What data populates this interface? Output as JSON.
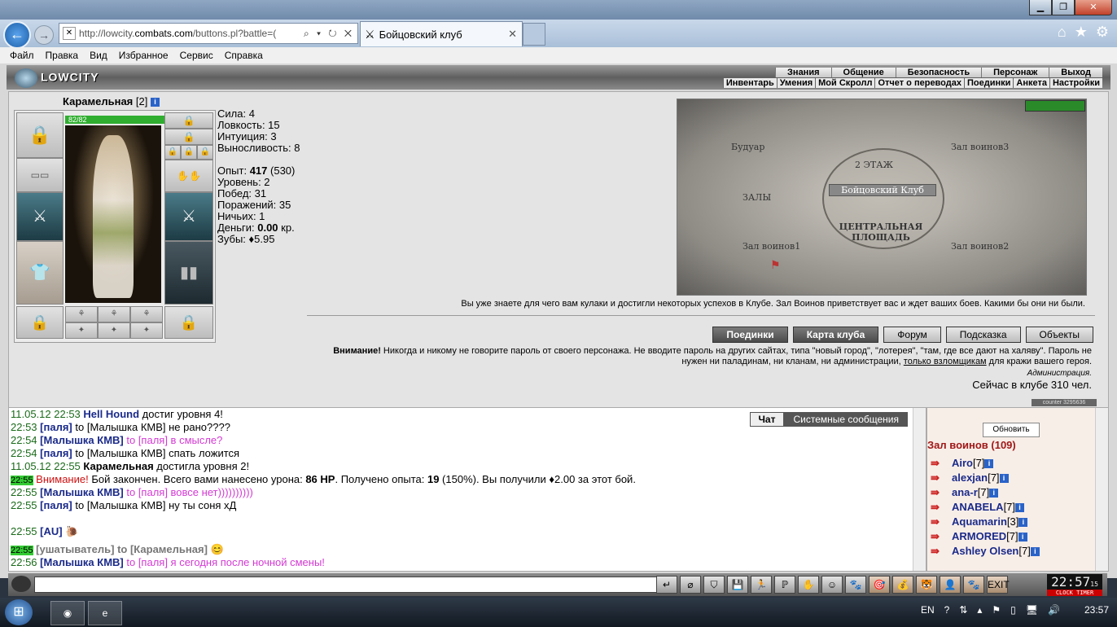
{
  "window": {
    "minimize": "▁",
    "maximize": "❐",
    "close": "✕"
  },
  "browser": {
    "url_prefix": "http://lowcity.",
    "url_domain": "combats.com",
    "url_rest": "/buttons.pl?battle=(",
    "address_controls": "⌕ ▾ ↻ ✕",
    "tab_title": "Бойцовский клуб",
    "tab_close": "✕",
    "nav_icons": [
      "⌂",
      "★",
      "⚙"
    ],
    "menu": [
      "Файл",
      "Правка",
      "Вид",
      "Избранное",
      "Сервис",
      "Справка"
    ]
  },
  "game": {
    "logo": "LOWCITY",
    "top_menu": [
      "Знания",
      "Общение",
      "Безопасность",
      "Персонаж",
      "Выход"
    ],
    "sub_menu": [
      "Инвентарь",
      "Умения",
      "Мой Скролл",
      "Отчет о переводах",
      "Поединки",
      "Анкета",
      "Настройки"
    ],
    "character": {
      "name": "Карамельная",
      "level": "[2]",
      "info": "i",
      "hp": "82/82"
    },
    "stats": {
      "strength": "Сила: 4",
      "agility": "Ловкость: 15",
      "intuition": "Интуиция: 3",
      "endurance": "Выносливость: 8",
      "exp_label": "Опыт:",
      "exp_value": "417",
      "exp_next": "(530)",
      "level": "Уровень: 2",
      "wins": "Побед: 31",
      "losses": "Поражений: 35",
      "draws": "Ничьих: 1",
      "money_label": "Деньги:",
      "money_value": "0.00",
      "money_unit": "кр.",
      "teeth": "Зубы: ♦5.95"
    },
    "map": {
      "boudoir": "Будуар",
      "hall3": "Зал воинов3",
      "floor2": "2 ЭТАЖ",
      "halls": "ЗАЛЫ",
      "club": "Бойцовский Клуб",
      "square": "ЦЕНТРАЛЬНАЯ ПЛОЩАДЬ",
      "hall1": "Зал воинов1",
      "hall2": "Зал воинов2"
    },
    "welcome": "Вы уже знаете для чего вам кулаки и достигли некоторых успехов в Клубе. Зал Воинов приветствует вас и ждет ваших боев. Какими бы они ни были.",
    "buttons": [
      "Поединки",
      "Карта клуба",
      "Форум",
      "Подсказка",
      "Объекты"
    ],
    "warning_bold": "Внимание!",
    "warning_text": " Никогда и никому не говорите пароль от своего персонажа. Не вводите пароль на других сайтах, типа \"новый город\", \"лотерея\", \"там, где все дают на халяву\". Пароль не нужен ни паладинам, ни кланам, ни администрации, ",
    "warning_link": "только взломщикам",
    "warning_end": " для кражи вашего героя.",
    "admin": "Администрация.",
    "online": "Сейчас в клубе 310 чел.",
    "counter": "counter 3295636"
  },
  "chat": {
    "tabs": [
      "Чат",
      "Системные сообщения"
    ],
    "messages": [
      {
        "time": "11.05.12 22:53",
        "parts": [
          {
            "c": "n",
            "t": "Hell Hound"
          },
          {
            "c": "",
            "t": " достиг уровня 4!"
          }
        ]
      },
      {
        "time": "22:53",
        "parts": [
          {
            "c": "n",
            "t": "[паля]"
          },
          {
            "c": "",
            "t": " to [Малышка КМВ] не рано????"
          }
        ]
      },
      {
        "time": "22:54",
        "parts": [
          {
            "c": "n",
            "t": "[Малышка КМВ]"
          },
          {
            "c": "pink",
            "t": " to [паля] в смысле?"
          }
        ]
      },
      {
        "time": "22:54",
        "parts": [
          {
            "c": "n",
            "t": "[паля]"
          },
          {
            "c": "",
            "t": " to [Малышка КМВ] спать ложится"
          }
        ]
      },
      {
        "time": "11.05.12 22:55",
        "parts": [
          {
            "c": "b",
            "t": "Карамельная"
          },
          {
            "c": "",
            "t": " достигла уровня 2!"
          }
        ]
      },
      {
        "time": "22:55",
        "hl": true,
        "parts": [
          {
            "c": "red",
            "t": "Внимание!"
          },
          {
            "c": "",
            "t": " Бой закончен. Всего вами нанесено урона: "
          },
          {
            "c": "b",
            "t": "86 HP"
          },
          {
            "c": "",
            "t": ". Получено опыта: "
          },
          {
            "c": "b",
            "t": "19"
          },
          {
            "c": "",
            "t": " (150%). Вы получили ♦2.00 за этот бой."
          }
        ]
      },
      {
        "time": "22:55",
        "parts": [
          {
            "c": "n",
            "t": "[Малышка КМВ]"
          },
          {
            "c": "pink",
            "t": " to [паля] вовсе нет))))))))))"
          }
        ]
      },
      {
        "time": "22:55",
        "parts": [
          {
            "c": "n",
            "t": "[паля]"
          },
          {
            "c": "",
            "t": " to [Малышка КМВ] ну ты соня хД"
          }
        ]
      },
      {
        "time": "22:55",
        "parts": [
          {
            "c": "n",
            "t": "[AU]"
          },
          {
            "c": "",
            "t": " 🐌"
          }
        ]
      },
      {
        "time": "22:55",
        "hl": true,
        "parts": [
          {
            "c": "gray",
            "t": "[ушатыватель]"
          },
          {
            "c": "gray",
            "t": " to [Карамельная]"
          },
          {
            "c": "",
            "t": " 😊"
          }
        ]
      },
      {
        "time": "22:56",
        "parts": [
          {
            "c": "n",
            "t": "[Малышка КМВ]"
          },
          {
            "c": "pink",
            "t": " to [паля] я сегодня после ночной смены!"
          }
        ]
      }
    ]
  },
  "players": {
    "refresh": "Обновить",
    "room": "Зал воинов (109)",
    "list": [
      {
        "name": "Airo",
        "lvl": "[7]"
      },
      {
        "name": "alexjan",
        "lvl": "[7]"
      },
      {
        "name": "ana-r",
        "lvl": "[7]"
      },
      {
        "name": "ANABELA",
        "lvl": "[7]"
      },
      {
        "name": "Aquamarin",
        "lvl": "[3]"
      },
      {
        "name": "ARMORED",
        "lvl": "[7]"
      },
      {
        "name": "Ashley Olsen",
        "lvl": "[7]"
      }
    ]
  },
  "toolbar": {
    "clock": "22:57",
    "clock_sec": "15",
    "clock_label": "CLOCK TIMER",
    "icons": [
      "↵",
      "⌀",
      "⛉",
      "💾",
      "🏃",
      "ℙ",
      "✋",
      "☺",
      "🐾",
      "🎯",
      "💰",
      "🐯",
      "👤",
      "🐾",
      "EXIT"
    ]
  },
  "taskbar": {
    "lang": "EN",
    "time": "23:57",
    "tray_icons": [
      "?",
      "⇅",
      "▴",
      "⚑",
      "▯",
      "🖥",
      "🔊"
    ]
  }
}
